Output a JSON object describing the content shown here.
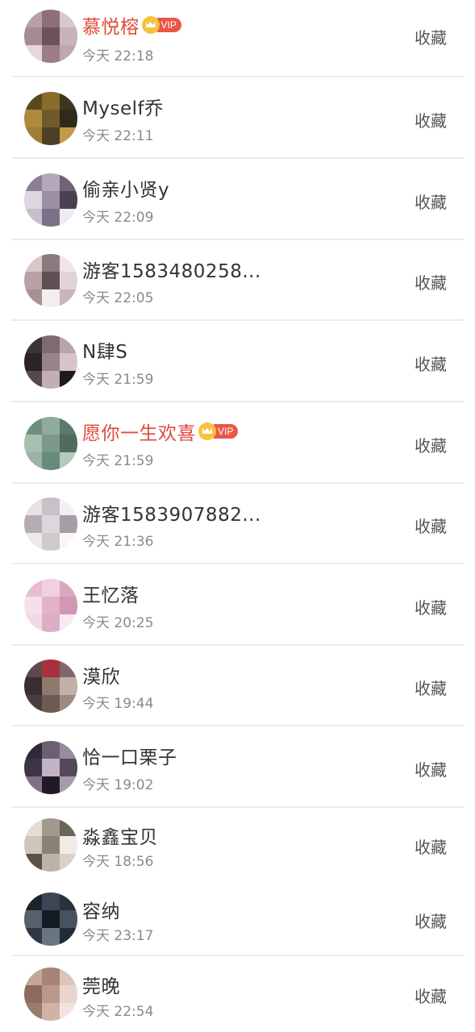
{
  "action_label": "收藏",
  "vip_badge_text": "VIP",
  "visitors": [
    {
      "name": "慕悦榕",
      "time": "今天 22:18",
      "vip": true
    },
    {
      "name": "Myself乔",
      "time": "今天 22:11",
      "vip": false
    },
    {
      "name": "偷亲小贤y",
      "time": "今天 22:09",
      "vip": false
    },
    {
      "name": "游客1583480258...",
      "time": "今天 22:05",
      "vip": false
    },
    {
      "name": "N肆S",
      "time": "今天 21:59",
      "vip": false
    },
    {
      "name": "愿你一生欢喜",
      "time": "今天 21:59",
      "vip": true
    },
    {
      "name": "游客1583907882...",
      "time": "今天 21:36",
      "vip": false
    },
    {
      "name": "王忆落",
      "time": "今天 20:25",
      "vip": false
    },
    {
      "name": "漠欣",
      "time": "今天 19:44",
      "vip": false
    },
    {
      "name": "恰一口栗子",
      "time": "今天 19:02",
      "vip": false
    },
    {
      "name": "淼鑫宝贝",
      "time": "今天 18:56",
      "vip": false
    },
    {
      "name": "容纳",
      "time": "今天 23:17",
      "vip": false
    },
    {
      "name": "莞晚",
      "time": "今天 22:54",
      "vip": false
    }
  ],
  "avatar_palettes": [
    [
      "#b7a1a6",
      "#8e6f78",
      "#d8c7cb",
      "#a88a92",
      "#6d525a",
      "#c9b3b8",
      "#e4d8da",
      "#9a7d85",
      "#bfa8ad"
    ],
    [
      "#5a4a22",
      "#8a6b2c",
      "#3f3620",
      "#b08a3a",
      "#6e5a2a",
      "#2f2a1c",
      "#9e7e36",
      "#4d4026",
      "#c29a48"
    ],
    [
      "#8c7f95",
      "#b3a9bb",
      "#6f6378",
      "#ddd6e0",
      "#9a8fa4",
      "#4a4150",
      "#c7bfcd",
      "#7d7186",
      "#efe9f1"
    ],
    [
      "#d8c6c8",
      "#8b7b7e",
      "#efe5e6",
      "#b8a2a6",
      "#5e5153",
      "#e2d4d6",
      "#a89194",
      "#f4eeef",
      "#c9b5b8"
    ],
    [
      "#3c3338",
      "#7e6a70",
      "#b8a3a8",
      "#2a2327",
      "#9a8388",
      "#d6c4c8",
      "#55484d",
      "#c3aeb3",
      "#1f1a1d"
    ],
    [
      "#6f8f7e",
      "#8fab9b",
      "#5b7a6a",
      "#a6bfb1",
      "#7c9a89",
      "#4f6c5d",
      "#99b3a4",
      "#688a78",
      "#b4cabd"
    ],
    [
      "#e6e1e5",
      "#c9c1c7",
      "#f3f0f2",
      "#b6adb4",
      "#ddd6db",
      "#a79ea5",
      "#ece8eb",
      "#cfc8cd",
      "#f8f6f7"
    ],
    [
      "#e7bcd0",
      "#f1d1e0",
      "#d9a6bf",
      "#f6dfea",
      "#e2b2c9",
      "#cf98b4",
      "#f3d8e5",
      "#dcaec5",
      "#fae9f1"
    ],
    [
      "#5b4a4f",
      "#a8323c",
      "#7d6a6f",
      "#3a2e32",
      "#8c7a6e",
      "#c3b0a8",
      "#4a3c40",
      "#6e5a50",
      "#9e8a80"
    ],
    [
      "#2f2a38",
      "#6b6070",
      "#9a8aa0",
      "#3e3446",
      "#c2b3c4",
      "#54485c",
      "#7f7285",
      "#1f1b26",
      "#a99aae"
    ],
    [
      "#e3ddd6",
      "#a39a8e",
      "#6e655a",
      "#cfc6bb",
      "#8b8276",
      "#f0ebe5",
      "#5a5248",
      "#bdb3a7",
      "#d9d1c7"
    ],
    [
      "#1d232b",
      "#3a4654",
      "#2a323c",
      "#55606c",
      "#141a21",
      "#46525e",
      "#2f3945",
      "#697582",
      "#222a33"
    ],
    [
      "#c4a79a",
      "#a88476",
      "#dcc4b9",
      "#8e6a5d",
      "#b9998b",
      "#e8d6cd",
      "#9c7a6c",
      "#cfb3a6",
      "#f0e3dc"
    ]
  ]
}
